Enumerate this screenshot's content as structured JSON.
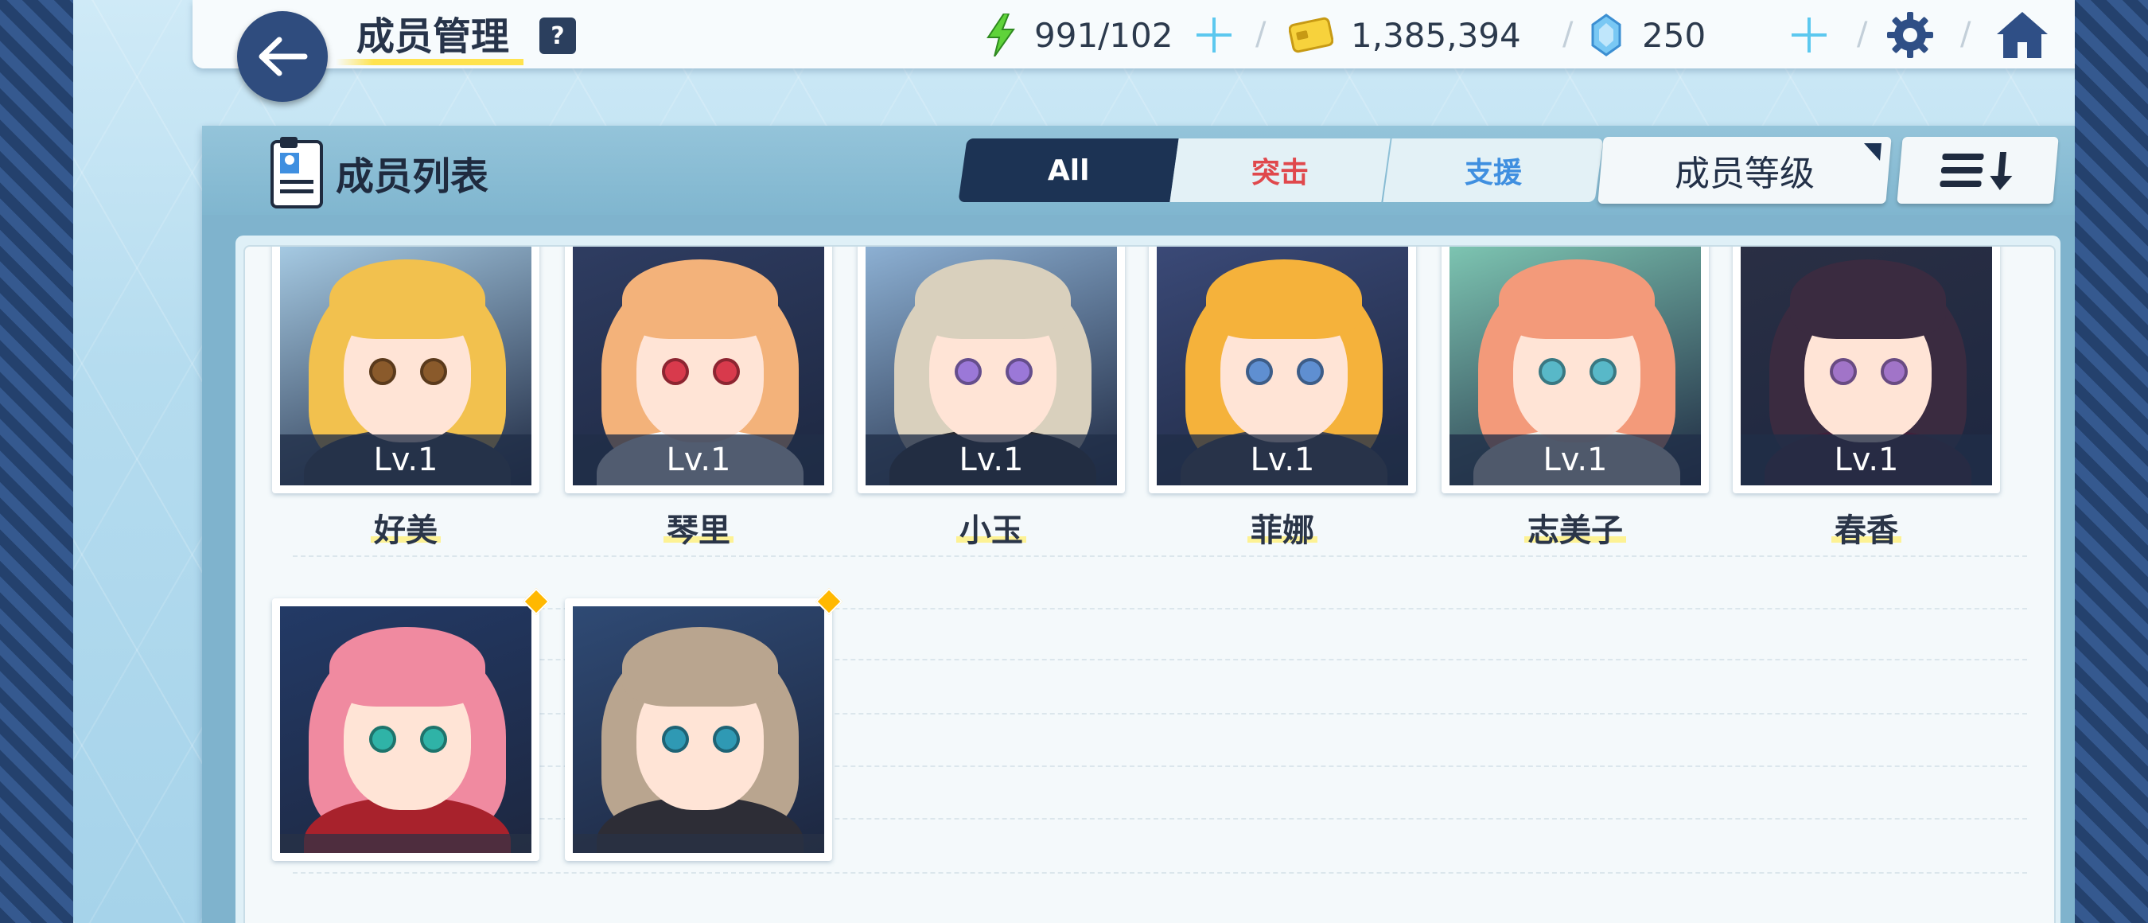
{
  "header": {
    "title": "成员管理",
    "help": "?",
    "energy": "991/102",
    "credits": "1,385,394",
    "gems": "250"
  },
  "panel": {
    "title": "成员列表",
    "tabs": {
      "all": "All",
      "strike": "突击",
      "support": "支援"
    },
    "sort_label": "成员等级"
  },
  "members": [
    {
      "name": "好美",
      "level": "Lv.1",
      "hair": "#f2c14e",
      "eyes": "#8a5a2b",
      "outfit": "#3a3f4d",
      "bg": "#a8cde6"
    },
    {
      "name": "琴里",
      "level": "Lv.1",
      "hair": "#f3b27a",
      "eyes": "#d83a4c",
      "outfit": "#ffffff",
      "bg": "#2f3d62"
    },
    {
      "name": "小玉",
      "level": "Lv.1",
      "hair": "#d9d0bd",
      "eyes": "#9b78d8",
      "outfit": "#2a2a30",
      "bg": "#8fb3d6"
    },
    {
      "name": "菲娜",
      "level": "Lv.1",
      "hair": "#f5b23b",
      "eyes": "#5f8fd1",
      "outfit": "#44464f",
      "bg": "#3b4a78"
    },
    {
      "name": "志美子",
      "level": "Lv.1",
      "hair": "#f39a7a",
      "eyes": "#58b8c8",
      "outfit": "#f5f2e8",
      "bg": "#7fc8b4"
    },
    {
      "name": "春香",
      "level": "Lv.1",
      "hair": "#3a2b40",
      "eyes": "#a174c8",
      "outfit": "#42203a",
      "bg": "#2a2f44"
    },
    {
      "name": "",
      "level": "",
      "hair": "#f08aa0",
      "eyes": "#2fb3a7",
      "outfit": "#a8222c",
      "bg": "#233a66"
    },
    {
      "name": "",
      "level": "",
      "hair": "#b9a58f",
      "eyes": "#2f99b4",
      "outfit": "#2d2d36",
      "bg": "#2f4a74"
    }
  ]
}
